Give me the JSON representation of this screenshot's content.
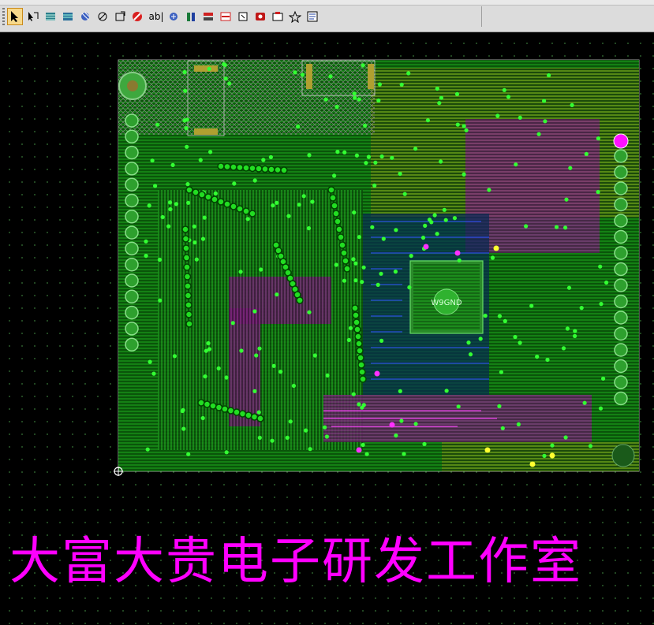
{
  "toolbar": {
    "buttons": [
      {
        "name": "select-tool",
        "icon": "arrow-cursor-icon",
        "active": true
      },
      {
        "name": "route-tool",
        "icon": "route-arrow-icon"
      },
      {
        "name": "copper-pour-tool",
        "icon": "copper-pour-icon"
      },
      {
        "name": "plane-area-tool",
        "icon": "plane-area-icon"
      },
      {
        "name": "hatch-tool",
        "icon": "hatch-icon"
      },
      {
        "name": "pour-outline-tool",
        "icon": "pour-outline-icon"
      },
      {
        "name": "cutout-tool",
        "icon": "cutout-icon"
      },
      {
        "name": "no-entry-tool",
        "icon": "no-entry-icon"
      },
      {
        "name": "text-tool",
        "icon": "text-icon",
        "label": "ab|"
      },
      {
        "name": "flood-tool",
        "icon": "flood-icon"
      },
      {
        "name": "layer-pair-tool",
        "icon": "layer-pair-icon"
      },
      {
        "name": "dimension-tool",
        "icon": "dimension-icon"
      },
      {
        "name": "drc-tool",
        "icon": "drc-icon"
      },
      {
        "name": "component-tool",
        "icon": "component-icon"
      },
      {
        "name": "keepout-tool",
        "icon": "keepout-icon"
      },
      {
        "name": "cam-tool",
        "icon": "cam-icon"
      },
      {
        "name": "drill-tool",
        "icon": "drill-icon"
      },
      {
        "name": "report-tool",
        "icon": "report-icon"
      }
    ]
  },
  "board": {
    "chip_label": "W9GND",
    "colors": {
      "background": "#000000",
      "outline": "#a0a0a0",
      "copper_top": "#00c000",
      "copper_bright": "#33ff33",
      "copper_dark": "#006600",
      "inner_layer": "#b000b0",
      "pad_yellow": "#c8c800",
      "highlight_pad": "#ff00ff",
      "blue_trace": "#2040ff"
    }
  },
  "caption": "大富大贵电子研发工作室"
}
